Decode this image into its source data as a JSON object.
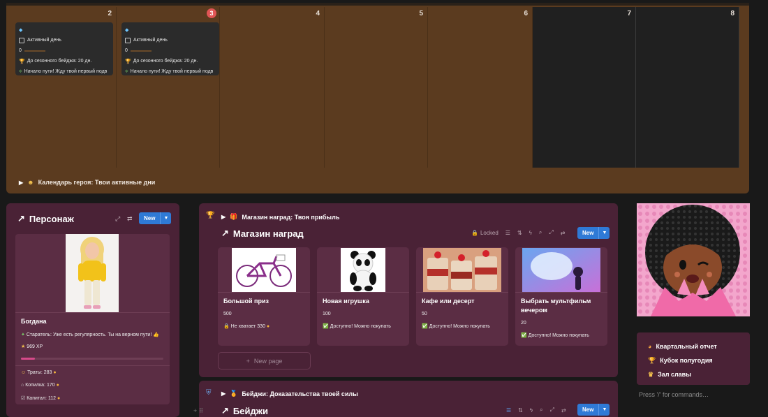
{
  "calendar": {
    "days": [
      {
        "num": "2",
        "today": false,
        "dark": false
      },
      {
        "num": "3",
        "today": true,
        "dark": false
      },
      {
        "num": "4",
        "today": false,
        "dark": false
      },
      {
        "num": "5",
        "today": false,
        "dark": false
      },
      {
        "num": "6",
        "today": false,
        "dark": false
      },
      {
        "num": "7",
        "today": false,
        "dark": true
      },
      {
        "num": "8",
        "today": false,
        "dark": true
      }
    ],
    "entry": {
      "active_day": "Активный день",
      "progress": "0",
      "seasonal": "До сезонного бейджа: 20 дн.",
      "start": "Начало пути! Жду твой первый подв"
    },
    "footer": "Календарь героя: Твои активные дни"
  },
  "character": {
    "title": "Персонаж",
    "new_label": "New",
    "name": "Богдана",
    "status": "Старатель: Уже есть регулярность. Ты на верном пути!",
    "xp": "969 XP",
    "xp_progress": 0.1,
    "spend": "Траты: 283",
    "savings": "Копилка: 170",
    "capital": "Капитал: 112"
  },
  "shop": {
    "toggle_label": "Магазин наград: Твоя прибыль",
    "title": "Магазин наград",
    "locked_label": "Locked",
    "new_label": "New",
    "items": [
      {
        "title": "Большой приз",
        "price": "500",
        "status": "Не хватает 330"
      },
      {
        "title": "Новая игрушка",
        "price": "100",
        "status": "Доступно! Можно покупать"
      },
      {
        "title": "Кафе или десерт",
        "price": "50",
        "status": "Доступно! Можно покупать"
      },
      {
        "title": "Выбрать мультфильм вечером",
        "price": "20",
        "status": "Доступно! Можно покупать"
      }
    ],
    "new_page": "New page"
  },
  "badges": {
    "toggle_label": "Бейджи: Доказательства твоей силы",
    "title": "Бейджи",
    "new_label": "New"
  },
  "links": [
    "Квартальный отчет",
    "Кубок полугодия",
    "Зал славы"
  ],
  "command_hint": "Press '/' for commands…",
  "colors": {
    "accent": "#2f7ad6",
    "calendar_bg": "#5b3b1f",
    "panel_bg": "#4a2236"
  }
}
